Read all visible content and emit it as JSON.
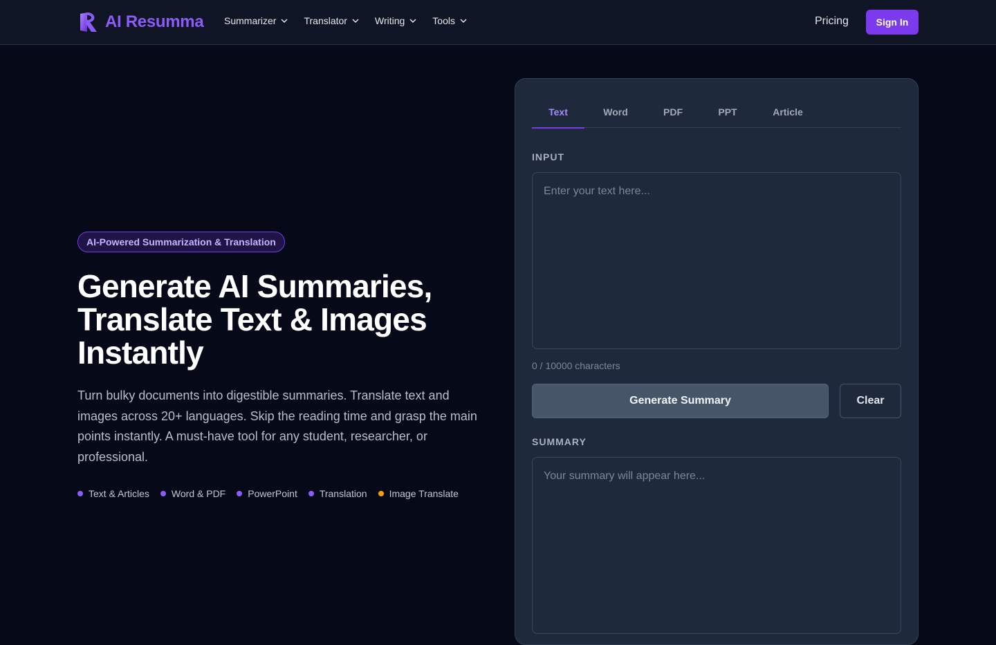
{
  "brand": {
    "name": "AI Resumma",
    "accent": "#7c3aed"
  },
  "nav": {
    "items": [
      {
        "label": "Summarizer"
      },
      {
        "label": "Translator"
      },
      {
        "label": "Writing"
      },
      {
        "label": "Tools"
      }
    ],
    "pricing": "Pricing",
    "signin": "Sign In"
  },
  "hero": {
    "badge": "AI-Powered Summarization & Translation",
    "title_lines": [
      "Generate AI Summaries,",
      "Translate Text & Images",
      "Instantly"
    ],
    "description": "Turn bulky documents into digestible summaries. Translate text and images across 20+ languages. Skip the reading time and grasp the main points instantly. A must-have tool for any student, researcher, or professional.",
    "features": [
      {
        "label": "Text & Articles",
        "color": "#8b5cf6"
      },
      {
        "label": "Word & PDF",
        "color": "#8b5cf6"
      },
      {
        "label": "PowerPoint",
        "color": "#8b5cf6"
      },
      {
        "label": "Translation",
        "color": "#8b5cf6"
      },
      {
        "label": "Image Translate",
        "color": "#f59e0b"
      }
    ]
  },
  "panel": {
    "tabs": [
      {
        "label": "Text",
        "active": true
      },
      {
        "label": "Word"
      },
      {
        "label": "PDF"
      },
      {
        "label": "PPT"
      },
      {
        "label": "Article"
      }
    ],
    "input_label": "INPUT",
    "input_placeholder": "Enter your text here...",
    "char_count": "0 / 10000 characters",
    "generate_label": "Generate Summary",
    "clear_label": "Clear",
    "summary_label": "SUMMARY",
    "summary_placeholder": "Your summary will appear here..."
  }
}
